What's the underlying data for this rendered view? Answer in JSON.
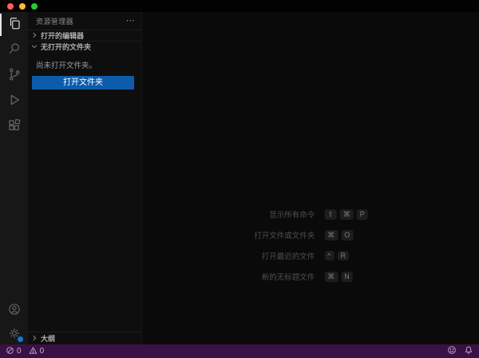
{
  "window": {
    "traffic_lights": {
      "close": "#ff5f57",
      "minimize": "#febc2e",
      "zoom": "#28c840"
    }
  },
  "activity_bar": {
    "items": [
      {
        "id": "explorer",
        "icon": "files-icon",
        "active": true
      },
      {
        "id": "search",
        "icon": "search-icon",
        "active": false
      },
      {
        "id": "source-control",
        "icon": "source-control-icon",
        "active": false
      },
      {
        "id": "run-debug",
        "icon": "debug-icon",
        "active": false
      },
      {
        "id": "extensions",
        "icon": "extensions-icon",
        "active": false
      }
    ],
    "bottom_items": [
      {
        "id": "accounts",
        "icon": "account-icon"
      },
      {
        "id": "settings",
        "icon": "gear-icon",
        "badge_color": "#1079d8"
      }
    ]
  },
  "sidebar": {
    "title": "资源管理器",
    "more_actions": "⋯",
    "open_editors_label": "打开的编辑器",
    "no_folder_label": "无打开的文件夹",
    "empty_message": "尚未打开文件夹。",
    "open_folder_button": "打开文件夹",
    "outline_label": "大纲"
  },
  "editor": {
    "watermark": [
      {
        "label": "显示所有命令",
        "keys": [
          "⇧",
          "⌘",
          "P"
        ]
      },
      {
        "label": "打开文件或文件夹",
        "keys": [
          "⌘",
          "O"
        ]
      },
      {
        "label": "打开最近的文件",
        "keys": [
          "^",
          "R"
        ]
      },
      {
        "label": "新的无标题文件",
        "keys": [
          "⌘",
          "N"
        ]
      }
    ]
  },
  "status_bar": {
    "errors": "0",
    "warnings": "0",
    "background": "#3a1144"
  },
  "colors": {
    "button_accent": "#0d5cab",
    "activity_bar_bg": "#171717",
    "sidebar_bg": "#0e0e0e",
    "editor_bg": "#0a0a0a"
  }
}
